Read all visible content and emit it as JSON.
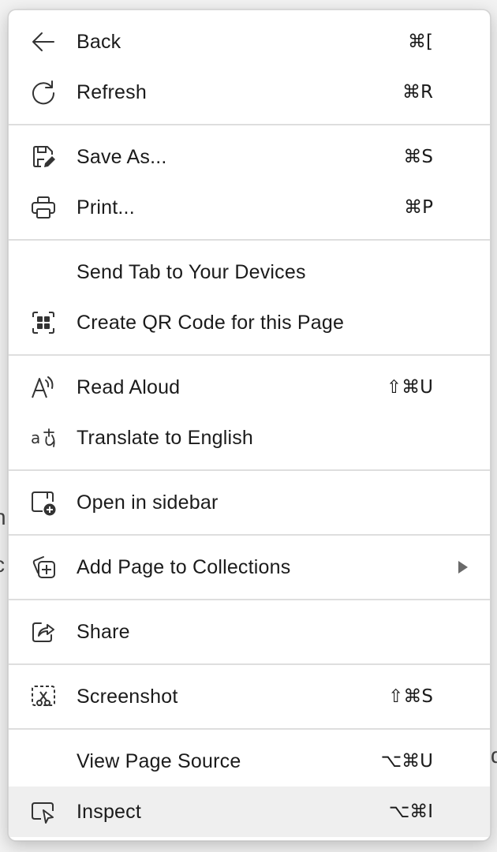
{
  "menu": {
    "back": {
      "label": "Back",
      "shortcut": "⌘["
    },
    "refresh": {
      "label": "Refresh",
      "shortcut": "⌘R"
    },
    "save_as": {
      "label": "Save As...",
      "shortcut": "⌘S"
    },
    "print": {
      "label": "Print...",
      "shortcut": "⌘P"
    },
    "send_tab": {
      "label": "Send Tab to Your Devices"
    },
    "qr_code": {
      "label": "Create QR Code for this Page"
    },
    "read_aloud": {
      "label": "Read Aloud",
      "shortcut": "⇧⌘U"
    },
    "translate": {
      "label": "Translate to English"
    },
    "open_sidebar": {
      "label": "Open in sidebar"
    },
    "collections": {
      "label": "Add Page to Collections"
    },
    "share": {
      "label": "Share"
    },
    "screenshot": {
      "label": "Screenshot",
      "shortcut": "⇧⌘S"
    },
    "view_source": {
      "label": "View Page Source",
      "shortcut": "⌥⌘U"
    },
    "inspect": {
      "label": "Inspect",
      "shortcut": "⌥⌘I"
    }
  },
  "icons": {
    "back": "arrow-left-icon",
    "refresh": "refresh-icon",
    "save_as": "save-icon",
    "print": "printer-icon",
    "qr_code": "qr-code-icon",
    "read_aloud": "read-aloud-icon",
    "translate": "translate-icon",
    "open_sidebar": "sidebar-add-icon",
    "collections": "collections-add-icon",
    "share": "share-icon",
    "screenshot": "screenshot-icon",
    "inspect": "inspect-icon"
  },
  "colors": {
    "menu_bg": "#ffffff",
    "hover_bg": "#efefef",
    "separator": "#dedede",
    "text": "#1b1b1b"
  }
}
